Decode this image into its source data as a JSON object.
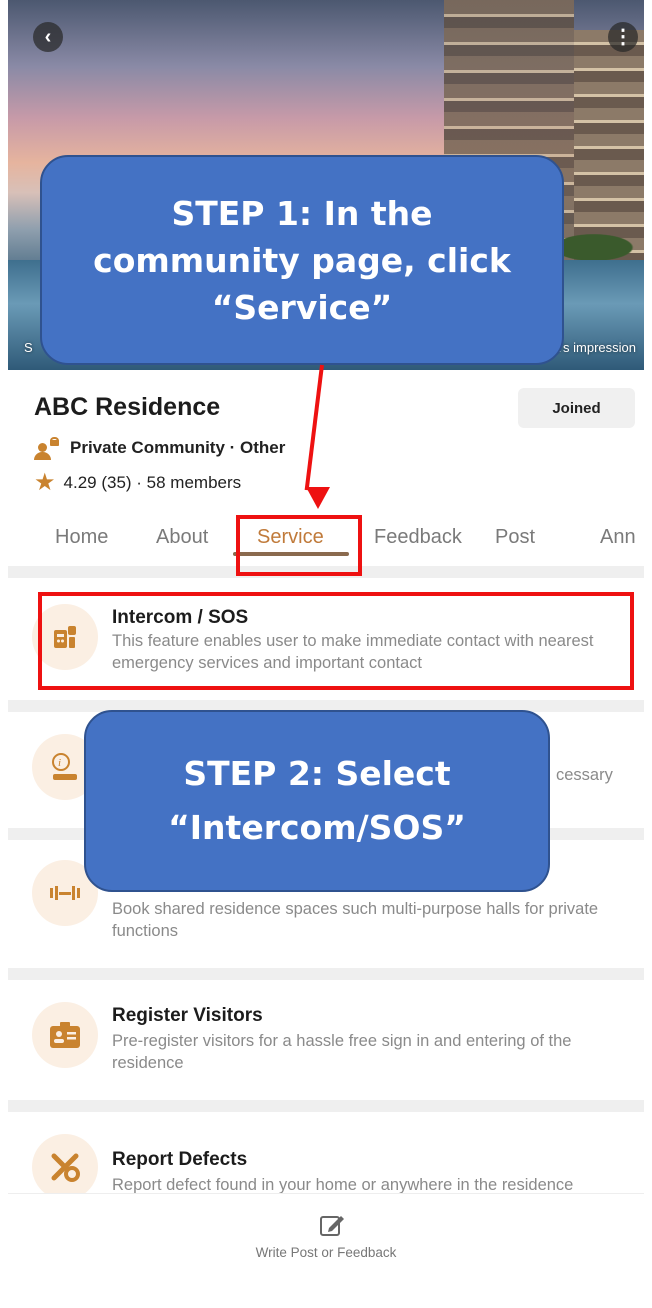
{
  "hero": {
    "back_icon": "chevron-left-icon",
    "more_icon": "more-vertical-icon",
    "caption_left": "S",
    "caption_right": "ist's impression"
  },
  "community": {
    "name": "ABC Residence",
    "join_status": "Joined",
    "privacy": "Private Community · Other",
    "rating": "4.29 (35) · 58 members"
  },
  "tabs": [
    {
      "label": "Home",
      "active": false
    },
    {
      "label": "About",
      "active": false
    },
    {
      "label": "Service",
      "active": true
    },
    {
      "label": "Feedback",
      "active": false
    },
    {
      "label": "Post",
      "active": false
    },
    {
      "label": "Ann",
      "active": false
    }
  ],
  "services": [
    {
      "title": "Intercom / SOS",
      "description": "This feature enables user to make immediate contact with nearest emergency services and important contact",
      "icon": "intercom-icon"
    },
    {
      "title": "",
      "description": "cessary",
      "icon": "info-icon"
    },
    {
      "title": "",
      "description": "Book shared residence spaces such multi-purpose halls for private functions",
      "icon": "facility-booking-icon"
    },
    {
      "title": "Register Visitors",
      "description": "Pre-register visitors for a hassle free sign in and entering of the residence",
      "icon": "visitor-id-icon"
    },
    {
      "title": "Report Defects",
      "description": "Report defect found in your home or anywhere in the residence",
      "icon": "tools-icon"
    }
  ],
  "bottom_bar": {
    "label": "Write Post or Feedback",
    "icon": "compose-icon"
  },
  "annotations": {
    "step1": "STEP 1: In the community page, click “Service”",
    "step2": "STEP 2: Select “Intercom/SOS”"
  },
  "colors": {
    "accent": "#c07a3a",
    "callout_fill": "#4472c4",
    "highlight": "#ee1111"
  }
}
